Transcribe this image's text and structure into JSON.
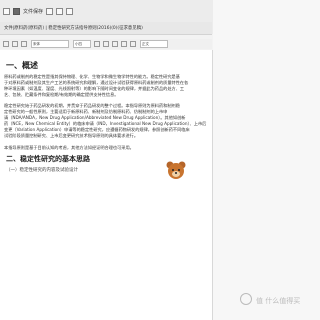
{
  "toolbar": {
    "save_label": "文件保存",
    "format_font": "宋体",
    "format_size": "小四",
    "format_style": "正文"
  },
  "document": {
    "title": "文件|原料药(原料药) | 稳定性研究方法指导原则(2016)(0)(征求意见稿)",
    "sections": [
      {
        "heading": "一、概述"
      },
      {
        "heading": "二、稳定性研究的基本思路"
      }
    ],
    "subheading": "（一）稳定性研究的内容及试验设计",
    "paragraphs": [
      "原料药或制剂的稳定性是指其保持物理、化学、生物学和微生物学特性的能力。稳定性研究是基",
      "于对原料药或制剂及其生产工艺的系统研究和理解，通过设计试验获得原料药或制剂的质量特性在各",
      "种环境因素（如温度、湿度、光线照射等）的影响下随时间变化的规律，并据此为药品的处方、工",
      "艺、包装、贮藏条件和复检期/有效期的确定提供支持性信息。",
      "稳定性研究始于药品研发的初期，并贯穿于药品研发的整个过程。本指导原则为原料药和制剂稳",
      "定性研究的一般性原则，主要适用于新原料药、新制剂及仿制原料药、仿制制剂的上市申",
      "请（NDA/ANDA，New Drug Application/Abbreviated New Drug Application）。其他如创新",
      "药（NCE，New Chemical Entity）的临床申请（IND，Investigational New Drug Application）、上市后",
      "变更（Variation Application）申请等的稳定性研究，应遵循药物研发的规律，参照创新药不同临床",
      "试验阶段质量控制研究、上市后变更研究技术指导原则的具体要求进行。",
      "本指导原则是基于目前认知的考虑，其他方法如经证明合理也可采用。"
    ]
  },
  "watermark": {
    "text": "值 什么值得买"
  }
}
